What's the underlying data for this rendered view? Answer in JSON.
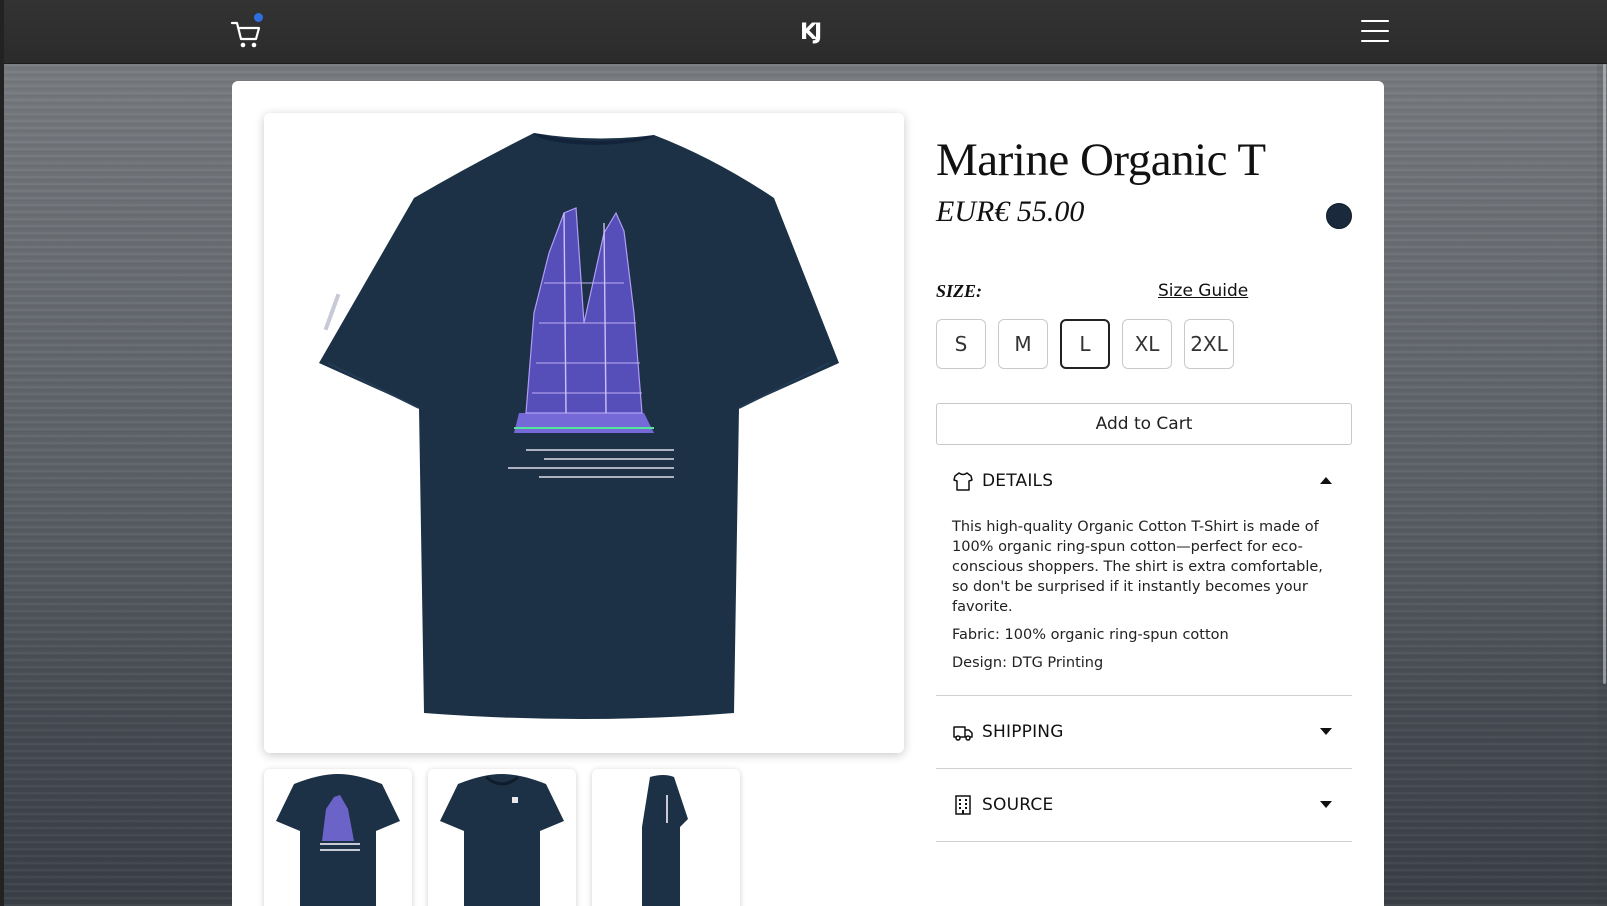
{
  "topbar": {
    "logo_text": "KJ",
    "cart_icon": "cart-icon",
    "menu_icon": "hamburger-menu-icon",
    "cart_badge_color": "#2f6fe0"
  },
  "product": {
    "title": "Marine Organic T",
    "price": "EUR€ 55.00",
    "color_swatch": "#1a2a3c",
    "size_label": "SIZE:",
    "size_guide_label": "Size Guide",
    "sizes": [
      "S",
      "M",
      "L",
      "XL",
      "2XL"
    ],
    "selected_size": "L",
    "add_to_cart_label": "Add to Cart"
  },
  "accordion": {
    "details": {
      "label": "DETAILS",
      "icon": "tshirt-icon",
      "expanded": true,
      "description": "This high-quality Organic Cotton T-Shirt is made of 100% organic ring-spun cotton—perfect for eco-conscious shoppers. The shirt is extra comfortable, so don't be surprised if it instantly becomes your favorite.",
      "fabric": "Fabric: 100% organic ring-spun cotton",
      "design": "Design: DTG Printing"
    },
    "shipping": {
      "label": "SHIPPING",
      "icon": "truck-icon",
      "expanded": false
    },
    "source": {
      "label": "SOURCE",
      "icon": "building-icon",
      "expanded": false
    }
  },
  "gallery": {
    "main_image": "navy t-shirt back with ship print",
    "thumbnails": [
      "back-view",
      "front-view",
      "side-view"
    ]
  },
  "colors": {
    "shirt_navy": "#1c3145",
    "ship_print": "#9a7be6",
    "topbar": "#2b2b2b"
  }
}
